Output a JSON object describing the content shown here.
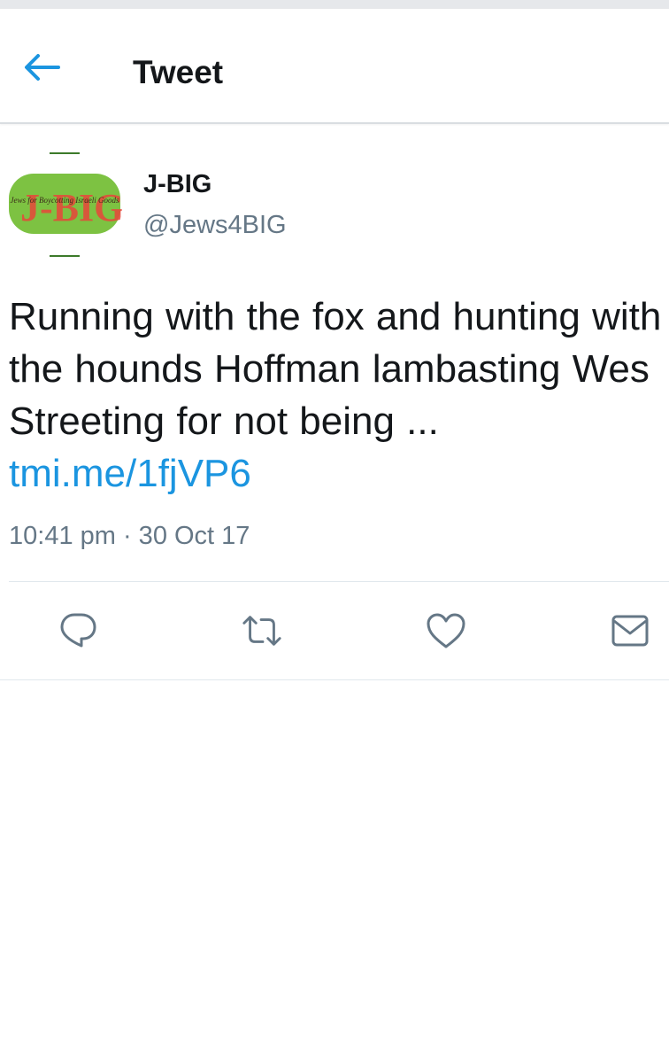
{
  "header": {
    "title": "Tweet",
    "back_icon": "back-arrow-icon"
  },
  "colors": {
    "accent": "#1b95e0",
    "text": "#14171a",
    "secondary_text": "#657786",
    "divider": "#e1e8ed",
    "avatar_green": "#7dc242",
    "avatar_red": "#e8463a"
  },
  "author": {
    "display_name": "J-BIG",
    "handle": "@Jews4BIG",
    "avatar_logo_text": "J-BIG",
    "avatar_logo_subtext": "Jews for Boycotting Israeli Goods"
  },
  "tweet": {
    "text": "Running with the fox and hunting with the hounds  Hoffman lambasting Wes Streeting for not being ... ",
    "link": "tmi.me/1fjVP6",
    "timestamp": "10:41 pm · 30 Oct 17"
  },
  "actions": [
    {
      "name": "reply",
      "icon": "reply-icon"
    },
    {
      "name": "retweet",
      "icon": "retweet-icon"
    },
    {
      "name": "like",
      "icon": "heart-icon"
    },
    {
      "name": "direct-message",
      "icon": "envelope-icon"
    }
  ]
}
